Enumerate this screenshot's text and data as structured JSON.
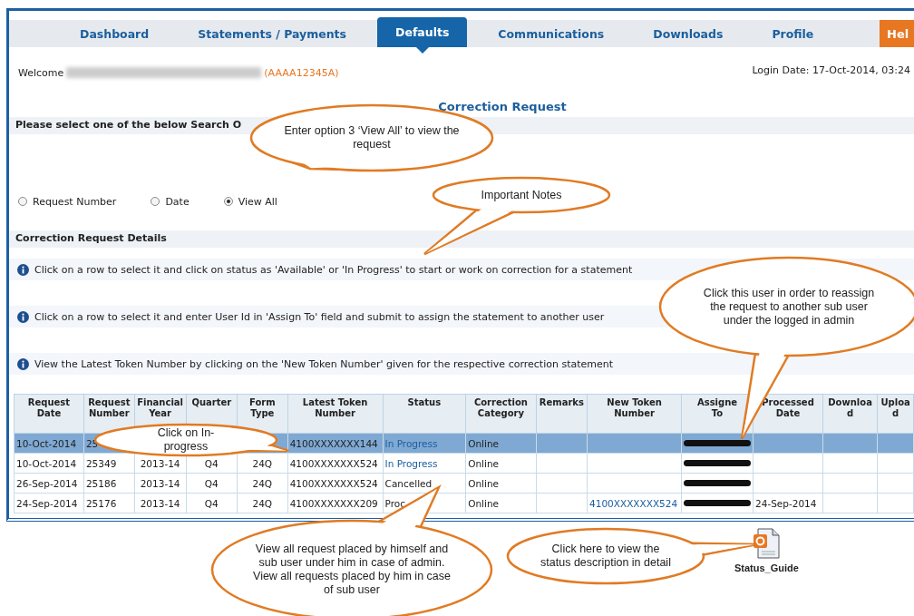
{
  "nav": {
    "tabs": [
      {
        "label": "Dashboard",
        "selected": false
      },
      {
        "label": "Statements / Payments",
        "selected": false
      },
      {
        "label": "Defaults",
        "selected": true
      },
      {
        "label": "Communications",
        "selected": false
      },
      {
        "label": "Downloads",
        "selected": false
      },
      {
        "label": "Profile",
        "selected": false
      }
    ],
    "help": "Hel"
  },
  "welcome": {
    "label": "Welcome",
    "id": "(AAAA12345A)",
    "login_date": "Login Date: 17-Oct-2014, 03:24"
  },
  "title": "Correction Request",
  "search": {
    "heading": "Please select one of the below Search O",
    "options": [
      {
        "label": "Request Number",
        "selected": false
      },
      {
        "label": "Date",
        "selected": false
      },
      {
        "label": "View All",
        "selected": true
      }
    ]
  },
  "details": {
    "heading": "Correction Request Details",
    "notes": [
      "Click on a row to select it and click on status as 'Available' or 'In Progress' to start or work on correction for a statement",
      "Click on a row to select it and enter User Id in 'Assign To' field and submit to assign the statement to another user",
      "View the Latest Token Number by clicking on the 'New Token Number' given for the respective correction statement"
    ]
  },
  "table": {
    "columns": [
      "Request Date",
      "Request Number",
      "Financial Year",
      "Quarter",
      "Form Type",
      "Latest Token Number",
      "Status",
      "Correction Category",
      "Remarks",
      "New Token Number",
      "Assigne To",
      "Processed Date",
      "Download",
      "Upload"
    ],
    "rows": [
      {
        "selected": true,
        "cells": {
          "request_date": "10-Oct-2014",
          "request_number": "25",
          "latest_token": "4100XXXXXXX144",
          "status": "In Progress",
          "category": "Online"
        },
        "status_link": true
      },
      {
        "selected": false,
        "cells": {
          "request_date": "10-Oct-2014",
          "request_number": "25349",
          "year": "2013-14",
          "quarter": "Q4",
          "form": "24Q",
          "latest_token": "4100XXXXXXX524",
          "status": "In Progress",
          "category": "Online"
        },
        "status_link": true
      },
      {
        "selected": false,
        "cells": {
          "request_date": "26-Sep-2014",
          "request_number": "25186",
          "year": "2013-14",
          "quarter": "Q4",
          "form": "24Q",
          "latest_token": "4100XXXXXXX524",
          "status": "Cancelled",
          "category": "Online"
        },
        "status_link": false
      },
      {
        "selected": false,
        "cells": {
          "request_date": "24-Sep-2014",
          "request_number": "25176",
          "year": "2013-14",
          "quarter": "Q4",
          "form": "24Q",
          "latest_token": "4100XXXXXXX209",
          "status": "Proc",
          "category": "Online",
          "new_token": "4100XXXXXXX524",
          "processed": "24-Sep-2014"
        },
        "status_link": false
      }
    ]
  },
  "status_guide": {
    "label": "Status_Guide"
  },
  "callouts": [
    "Enter option 3 ‘View All’ to view the request",
    "Important Notes",
    "Click this user in order to reassign the request to another sub user under the logged in admin",
    "Click on In-progress",
    "View all request placed by himself and sub user under him in case of admin. View all requests placed by him in case of sub user",
    "Click here to view the status description in detail"
  ]
}
